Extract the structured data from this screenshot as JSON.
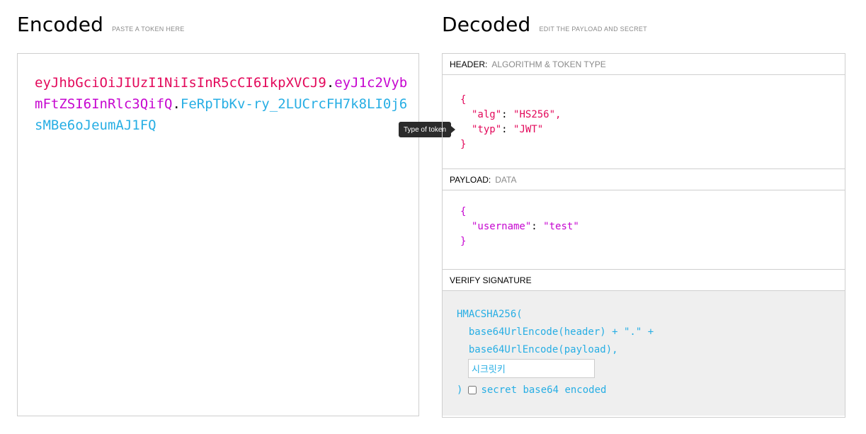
{
  "encoded": {
    "title": "Encoded",
    "subtitle": "PASTE A TOKEN HERE",
    "token": {
      "header": "eyJhbGciOiJIUzI1NiIsInR5cCI6IkpXVCJ9",
      "dot1": ".",
      "payload": "eyJ1c2VybmFtZSI6InRlc3QifQ",
      "dot2": ".",
      "signature": "FeRpTbKv-ry_2LUCrcFH7k8LI0j6sMBe6oJeumAJ1FQ"
    },
    "tooltip": "Type of token"
  },
  "decoded": {
    "title": "Decoded",
    "subtitle": "EDIT THE PAYLOAD AND SECRET",
    "header_section": {
      "label": "HEADER:",
      "label_sub": "ALGORITHM & TOKEN TYPE",
      "open": "{",
      "lines": [
        {
          "key": "\"alg\"",
          "colon": ":",
          "value": "\"HS256\","
        },
        {
          "key": "\"typ\"",
          "colon": ":",
          "value": "\"JWT\""
        }
      ],
      "close": "}"
    },
    "payload_section": {
      "label": "PAYLOAD:",
      "label_sub": "DATA",
      "open": "{",
      "lines": [
        {
          "key": "\"username\"",
          "colon": ":",
          "value": "\"test\""
        }
      ],
      "close": "}"
    },
    "signature_section": {
      "label": "VERIFY SIGNATURE",
      "line1": "HMACSHA256(",
      "line2": "  base64UrlEncode(header) + \".\" +",
      "line3": "  base64UrlEncode(payload),",
      "secret_value": "시크릿키",
      "close": ")",
      "checkbox_label": "secret base64 encoded",
      "checkbox_checked": false
    }
  },
  "colors": {
    "header": "#e3095b",
    "payload": "#c606d0",
    "signature": "#27aee4"
  }
}
